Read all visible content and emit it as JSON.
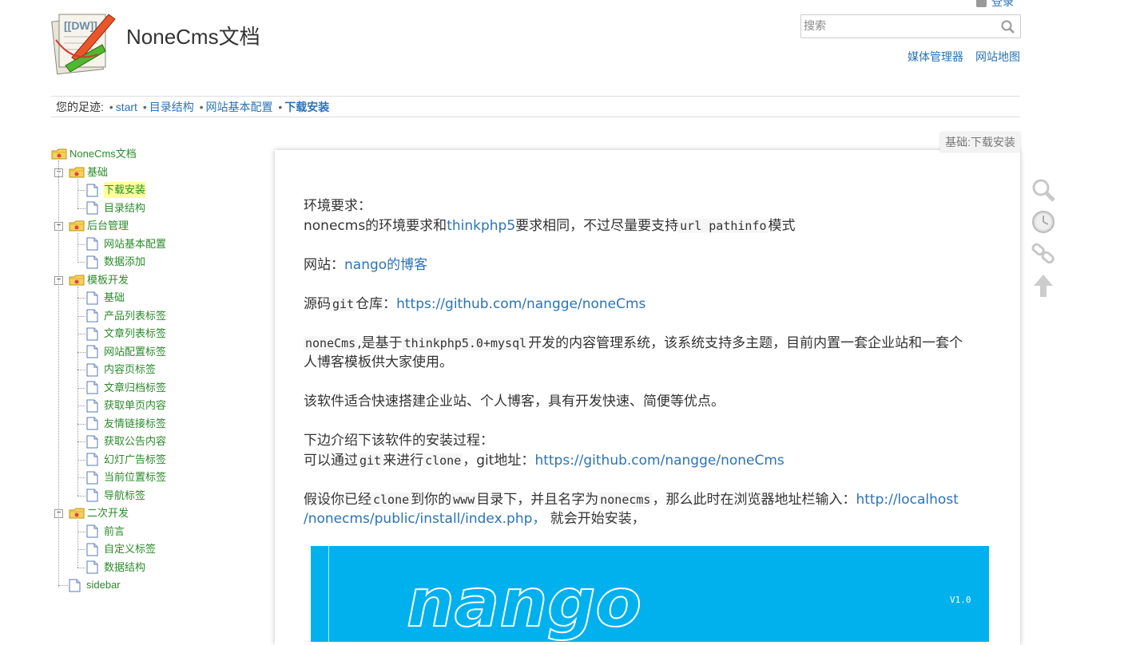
{
  "header": {
    "site_title": "NoneCms文档",
    "login_label": "登录",
    "search_placeholder": "搜索",
    "links": [
      "媒体管理器",
      "网站地图"
    ]
  },
  "breadcrumb": {
    "prefix": "您的足迹:",
    "items": [
      "start",
      "目录结构",
      "网站基本配置",
      "下载安装"
    ]
  },
  "sidebar": {
    "root": "NoneCms文档",
    "groups": [
      {
        "label": "基础",
        "pages": [
          "下载安装",
          "目录结构"
        ]
      },
      {
        "label": "后台管理",
        "pages": [
          "网站基本配置",
          "数据添加"
        ]
      },
      {
        "label": "模板开发",
        "pages": [
          "基础",
          "产品列表标签",
          "文章列表标签",
          "网站配置标签",
          "内容页标签",
          "文章归档标签",
          "获取单页内容",
          "友情链接标签",
          "获取公告内容",
          "幻灯广告标签",
          "当前位置标签",
          "导航标签"
        ]
      },
      {
        "label": "二次开发",
        "pages": [
          "前言",
          "自定义标签",
          "数据结构"
        ]
      }
    ],
    "tail": "sidebar",
    "active_page": "下载安装"
  },
  "content": {
    "page_id": "基础:下载安装",
    "env_heading": "环境要求：",
    "env_line_a": "nonecms的环境要求和",
    "env_link": "thinkphp5",
    "env_line_b": "要求相同，不过尽量要支持",
    "env_code": "url pathinfo",
    "env_line_c": "模式",
    "site_label": "网站：",
    "site_link": "nango的博客",
    "repo_a": "源码",
    "repo_code": "git",
    "repo_b": "仓库：",
    "repo_link": "https://github.com/nangge/noneCms",
    "intro_code1": "noneCms",
    "intro_a": ",是基于",
    "intro_code2": "thinkphp5.0+mysql",
    "intro_b": "开发的内容管理系统，该系统支持多主题，目前内置一套企业站和一套个",
    "intro_c": "人博客模板供大家使用。",
    "suit": "该软件适合快速搭建企业站、个人博客，具有开发快速、简便等优点。",
    "install_heading": "下边介绍下该软件的安装过程：",
    "clone_a": "可以通过",
    "clone_code1": "git",
    "clone_b": "来进行",
    "clone_code2": "clone",
    "clone_c": "，git地址：",
    "clone_link": "https://github.com/nangge/noneCms",
    "path_a": "假设你已经",
    "path_code1": "clone",
    "path_b": "到你的",
    "path_code2": "www",
    "path_c": "目录下，并且名字为",
    "path_code3": "nonecms",
    "path_d": "，那么此时在浏览器地址栏输入：",
    "path_link1": "http://localhost",
    "path_link2": "/nonecms/public/install/index.php，",
    "path_e": " 就会开始安装，",
    "banner_text": "nango",
    "banner_version": "V1.0"
  },
  "colors": {
    "link": "#2b73b7",
    "tree_link": "#2a8a2a",
    "banner_bg": "#00b1ee",
    "active_highlight": "#ffff99"
  },
  "tools": [
    "search-icon",
    "history-icon",
    "link-icon",
    "back-to-top-icon"
  ]
}
